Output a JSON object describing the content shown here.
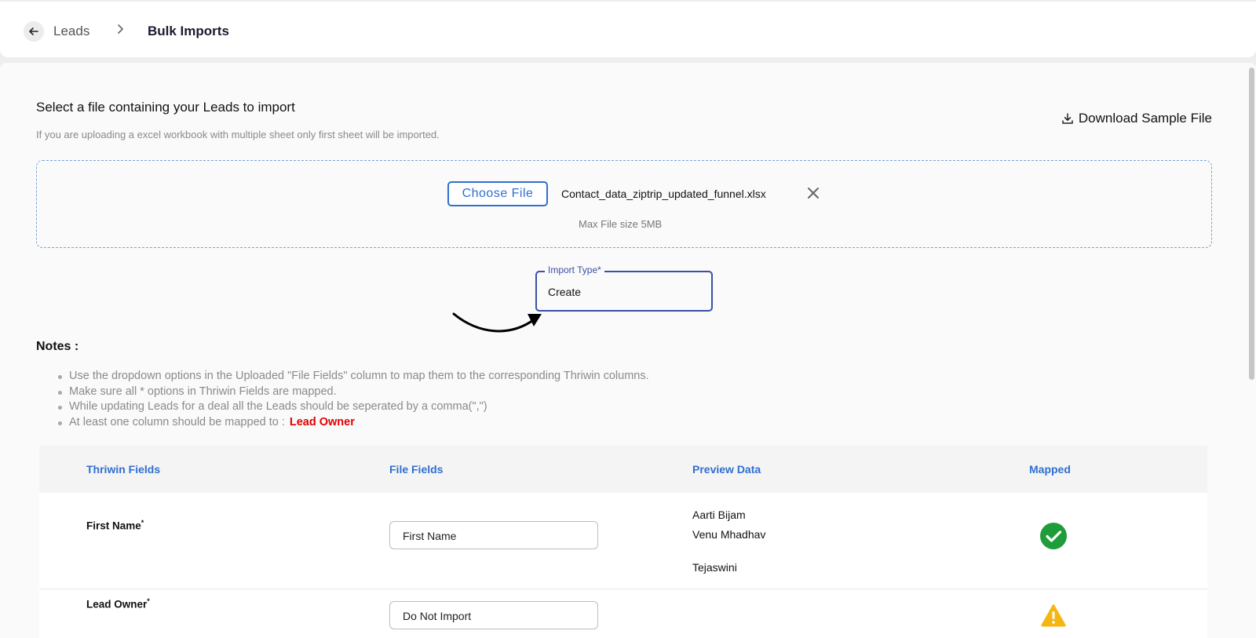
{
  "breadcrumb": {
    "parent": "Leads",
    "current": "Bulk Imports"
  },
  "upload": {
    "heading": "Select a file containing your Leads to import",
    "subheading": "If you are uploading a excel workbook with multiple sheet only first sheet will be imported.",
    "download_label": "Download Sample File",
    "choose_label": "Choose File",
    "file_name": "Contact_data_ziptrip_updated_funnel.xlsx",
    "max_size": "Max File size 5MB"
  },
  "import_type": {
    "label": "Import Type*",
    "value": "Create"
  },
  "notes": {
    "title": "Notes :",
    "items": [
      "Use the dropdown options in the Uploaded \"File Fields\" column to map them to the corresponding Thriwin columns.",
      "Make sure all * options in Thriwin Fields are mapped.",
      "While updating Leads for a deal all the Leads should be seperated by a comma(\",\")",
      "At least one column should be mapped to :"
    ],
    "highlight": "Lead Owner"
  },
  "table": {
    "headers": [
      "Thriwin Fields",
      "File Fields",
      "Preview Data",
      "Mapped"
    ],
    "rows": [
      {
        "field": "First Name",
        "required": "*",
        "file_field": "First Name",
        "preview": [
          "Aarti Bijam",
          "Venu Mhadhav",
          "Tejaswini"
        ],
        "status": "mapped"
      },
      {
        "field": "Lead Owner",
        "required": "*",
        "file_field": "Do Not Import",
        "preview": [],
        "status": "warning"
      }
    ]
  },
  "colors": {
    "accent": "#2f6fd0",
    "success": "#1f9d3a",
    "warning": "#f5b512",
    "highlight_red": "#e10000"
  }
}
